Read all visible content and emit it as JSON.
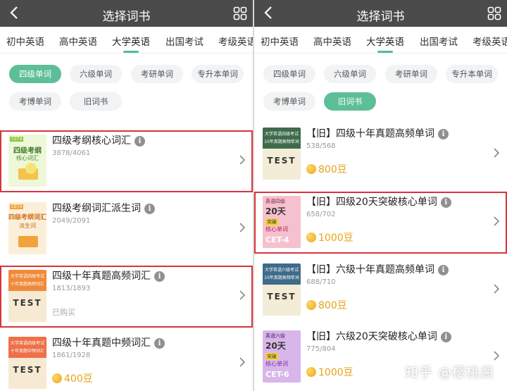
{
  "header": {
    "title": "选择词书"
  },
  "tabs": [
    "初中英语",
    "高中英语",
    "大学英语",
    "出国考试",
    "考级英语"
  ],
  "chips": [
    "四级单词",
    "六级单词",
    "考研单词",
    "专升本单词",
    "考博单词",
    "旧词书"
  ],
  "left": {
    "books": [
      {
        "title": "四级考纲核心词汇",
        "count": "3878/4061",
        "cover_badge": "CET4",
        "cover_title": "四级考纲",
        "cover_sub": "核心词汇",
        "highlight": true
      },
      {
        "title": "四级考纲词汇派生词",
        "count": "2049/2091",
        "cover_badge": "CET4",
        "cover_title": "四级考纲词汇",
        "cover_sub": "派生词"
      },
      {
        "title": "四级十年真题高频词汇",
        "count": "1813/1893",
        "status": "已购买",
        "cover_top": "大学英语四级考试",
        "cover_mid": "十年真题高频词汇",
        "cover_word": "TEST",
        "highlight": true
      },
      {
        "title": "四级十年真题中频词汇",
        "count": "1861/1928",
        "price": "400豆",
        "cover_top": "大学英语四级考试",
        "cover_mid": "十年真题中频词汇",
        "cover_word": "TEST"
      }
    ]
  },
  "right": {
    "books": [
      {
        "title": "【旧】四级十年真题高频单词",
        "count": "538/568",
        "price": "800豆",
        "cover_top": "大学英语四级考试",
        "cover_mid": "10年真题高频单词",
        "cover_word": "TEST"
      },
      {
        "title": "【旧】四级20天突破核心单词",
        "count": "658/702",
        "price": "1000豆",
        "cover_level": "英语四级",
        "cover_days": "20天",
        "cover_line": "突破",
        "cover_core": "核心单词",
        "cover_cet": "CET-4",
        "highlight": true
      },
      {
        "title": "【旧】六级十年真题高频单词",
        "count": "688/710",
        "price": "800豆",
        "cover_top": "大学英语六级考试",
        "cover_mid": "10年真题高频单词",
        "cover_word": "TEST"
      },
      {
        "title": "【旧】六级20天突破核心单词",
        "count": "775/804",
        "price": "1000豆",
        "cover_level": "英语六级",
        "cover_days": "20天",
        "cover_line": "突破",
        "cover_core": "核心单词",
        "cover_cet": "CET-6"
      }
    ]
  },
  "watermark": "知乎 @樱桃酱",
  "colors": {
    "header": "#4b4b4b",
    "accent": "#5dbf98",
    "highlight": "#d8343b",
    "price": "#e5a31a"
  }
}
